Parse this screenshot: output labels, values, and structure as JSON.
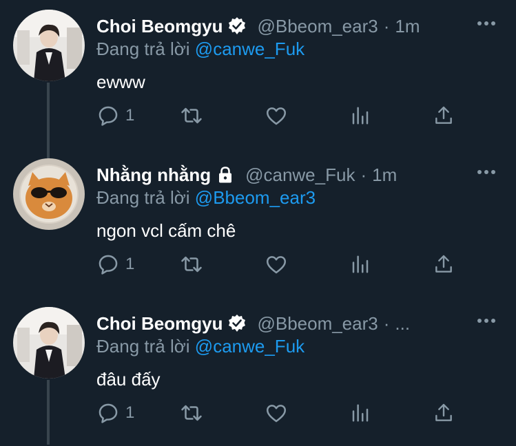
{
  "colors": {
    "background": "#15202b",
    "text": "#ffffff",
    "secondary": "#8899a6",
    "link": "#1d9bf0",
    "thread_line": "#38444d"
  },
  "tweets": [
    {
      "name": "Choi Beomgyu",
      "badge": "verified-badge-icon",
      "handle": "@Bbeom_ear3",
      "dot": "·",
      "time": "1m",
      "reply_prefix": "Đang trả lời",
      "reply_to": "@canwe_Fuk",
      "text": "ewww",
      "reply_count": "1"
    },
    {
      "name": "Nhằng nhằng",
      "badge": "lock-icon",
      "handle": "@canwe_Fuk",
      "dot": "·",
      "time": "1m",
      "reply_prefix": "Đang trả lời",
      "reply_to": "@Bbeom_ear3",
      "text": "ngon vcl cấm chê",
      "reply_count": "1"
    },
    {
      "name": "Choi Beomgyu",
      "badge": "verified-badge-icon",
      "handle": "@Bbeom_ear3",
      "dot": "·",
      "time": "...",
      "reply_prefix": "Đang trả lời",
      "reply_to": "@canwe_Fuk",
      "text": "đâu đấy",
      "reply_count": "1"
    }
  ]
}
